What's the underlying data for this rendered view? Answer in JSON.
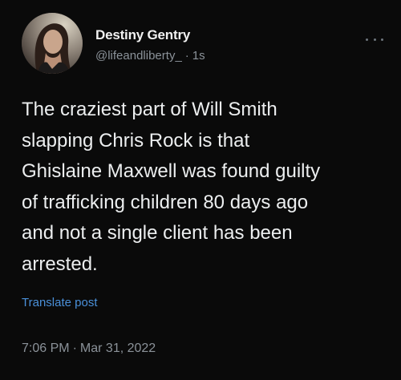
{
  "author": {
    "display_name": "Destiny Gentry",
    "handle": "@lifeandliberty_",
    "separator": "·",
    "relative_time": "1s"
  },
  "tweet": {
    "text_lines": [
      "The craziest part of Will Smith",
      "slapping Chris Rock is that",
      "Ghislaine Maxwell was found guilty",
      "of trafficking children 80 days ago",
      "and not a single client has been",
      "arrested."
    ],
    "translate_label": "Translate post",
    "time": "7:06 PM",
    "time_separator": "·",
    "date": "Mar 31, 2022"
  },
  "icons": {
    "more": "more-options-icon",
    "avatar": "profile-avatar"
  },
  "colors": {
    "background": "#0a0a0a",
    "primary_text": "#eceeef",
    "secondary_text": "#8b9299",
    "link": "#4a90d9"
  }
}
